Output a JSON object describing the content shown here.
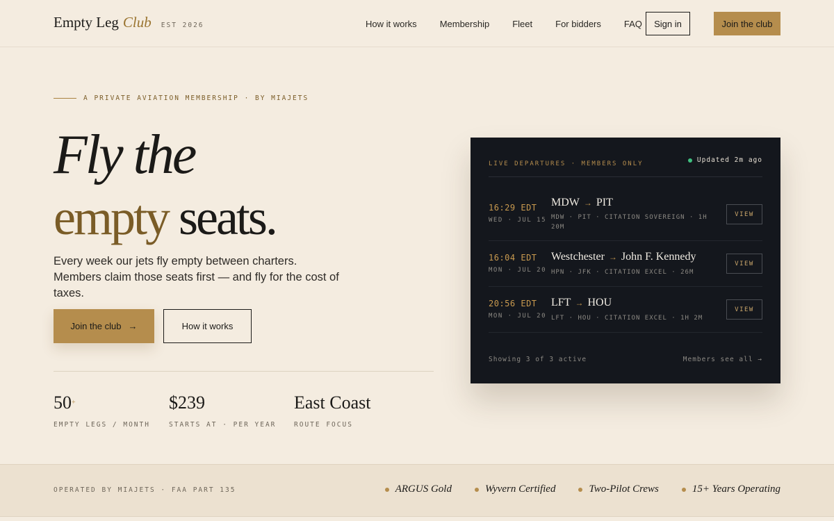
{
  "header": {
    "brand_name": "Empty Leg",
    "brand_club": "Club",
    "brand_est": "EST 2026",
    "nav": [
      "How it works",
      "Membership",
      "Fleet",
      "For bidders",
      "FAQ"
    ],
    "signin_label": "Sign in",
    "join_label": "Join the club"
  },
  "hero": {
    "eyebrow": "A PRIVATE AVIATION MEMBERSHIP · BY MIAJETS",
    "title_line1": "Fly the",
    "title_empty": "empty",
    "title_seats": "seats.",
    "lede": "Every week our jets fly empty between charters. Members claim those seats first — and fly for the cost of taxes.",
    "cta_primary": "Join the club",
    "cta_primary_arrow": "→",
    "cta_secondary": "How it works"
  },
  "stats": [
    {
      "value": "50",
      "sup": "+",
      "label": "EMPTY LEGS / MONTH"
    },
    {
      "value": "$239",
      "sup": "",
      "label": "STARTS AT · PER YEAR"
    },
    {
      "value": "East Coast",
      "sup": "",
      "label": "ROUTE FOCUS"
    }
  ],
  "departures": {
    "title": "LIVE DEPARTURES · MEMBERS ONLY",
    "updated": "Updated 2m ago",
    "flights": [
      {
        "time": "16:29 EDT",
        "date": "WED · JUL 15",
        "from": "MDW",
        "to": "PIT",
        "meta": "MDW · PIT · CITATION SOVEREIGN · 1H 20M",
        "action": "VIEW"
      },
      {
        "time": "16:04 EDT",
        "date": "MON · JUL 20",
        "from": "Westchester",
        "to": "John F. Kennedy",
        "meta": "HPN · JFK · CITATION EXCEL · 26M",
        "action": "VIEW"
      },
      {
        "time": "20:56 EDT",
        "date": "MON · JUL 20",
        "from": "LFT",
        "to": "HOU",
        "meta": "LFT · HOU · CITATION EXCEL · 1H 2M",
        "action": "VIEW"
      }
    ],
    "arrow": "→",
    "footer_left": "Showing 3 of 3 active",
    "footer_right": "Members see all →"
  },
  "band": {
    "operated": "OPERATED BY MIAJETS · FAA PART 135",
    "badges": [
      "ARGUS Gold",
      "Wyvern Certified",
      "Two-Pilot Crews",
      "15+ Years Operating"
    ]
  },
  "colors": {
    "background": "#f4ece0",
    "accent_gold": "#b58d4d",
    "accent_brown": "#7a5c27",
    "card_dark": "#14171d",
    "live_green": "#3fbf7f"
  }
}
